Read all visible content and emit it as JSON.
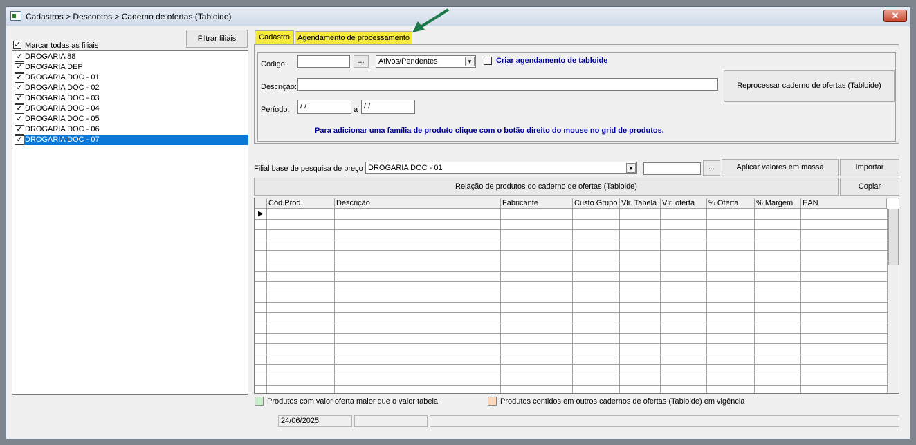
{
  "window": {
    "title": "Cadastros > Descontos > Caderno de ofertas (Tabloide)",
    "close_label": "✕"
  },
  "left": {
    "filter_button": "Filtrar filiais",
    "select_all_label": "Marcar todas as filiais",
    "filiais": [
      {
        "label": "DROGARIA 88",
        "checked": true
      },
      {
        "label": "DROGARIA DEP",
        "checked": true
      },
      {
        "label": "DROGARIA DOC - 01",
        "checked": true
      },
      {
        "label": "DROGARIA DOC - 02",
        "checked": true
      },
      {
        "label": "DROGARIA DOC - 03",
        "checked": true
      },
      {
        "label": "DROGARIA DOC - 04",
        "checked": true
      },
      {
        "label": "DROGARIA DOC - 05",
        "checked": true
      },
      {
        "label": "DROGARIA DOC - 06",
        "checked": true
      },
      {
        "label": "DROGARIA DOC - 07",
        "checked": true,
        "selected": true
      }
    ]
  },
  "tabs": [
    {
      "label": "Cadastro"
    },
    {
      "label": "Agendamento de processamento"
    }
  ],
  "form": {
    "codigo_label": "Código:",
    "codigo_value": "",
    "lookup_label": "...",
    "status_value": "Ativos/Pendentes",
    "criar_agendamento_label": "Criar agendamento de tabloide",
    "descricao_label": "Descrição:",
    "descricao_value": "",
    "periodo_label": "Período:",
    "periodo_start": " / /",
    "periodo_sep": "a",
    "periodo_end": " / /",
    "reprocessar_button": "Reprocessar caderno de ofertas (Tabloide)",
    "hint": "Para adicionar uma família de produto clique com o botão direito do  mouse no grid de produtos."
  },
  "filial_base": {
    "label": "Filial base de pesquisa de preço",
    "value": "DROGARIA DOC - 01",
    "lookup_label": "...",
    "aplicar_button": "Aplicar valores em massa",
    "importar_button": "Importar",
    "relacao_button": "Relação de produtos do caderno de ofertas (Tabloide)",
    "copiar_button": "Copiar"
  },
  "grid": {
    "columns": [
      "",
      "Cód.Prod.",
      "Descrição",
      "Fabricante",
      "Custo Grupo",
      "Vlr. Tabela",
      "Vlr. oferta",
      "% Oferta",
      "% Margem",
      "EAN"
    ]
  },
  "legend": {
    "green_label": "Produtos com valor oferta maior que o valor tabela",
    "green_color": "#c8f0c8",
    "orange_label": "Produtos contidos em outros cadernos de ofertas (Tabloide) em vigência",
    "orange_color": "#f8d8b8"
  },
  "status": {
    "date": "24/06/2025"
  },
  "colors": {
    "tab_highlight": "#f5e93c",
    "selected_row": "#0a78d7",
    "hint_text": "#0000a0",
    "arrow": "#1e7a4a"
  }
}
